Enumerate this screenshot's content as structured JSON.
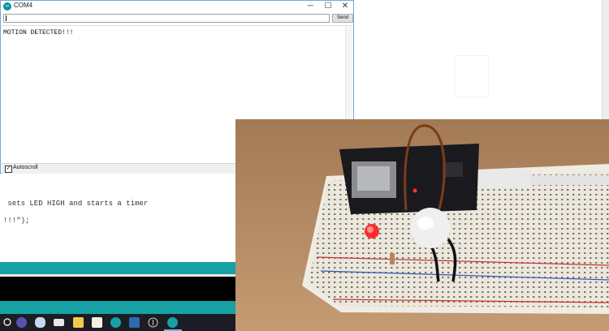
{
  "serial_monitor": {
    "title": "COM4",
    "send_label": "Send",
    "output_text": "MOTION DETECTED!!!",
    "autoscroll_label": "Autoscroll",
    "autoscroll_checked": "✓",
    "minimize_glyph": "─",
    "maximize_glyph": "☐",
    "close_glyph": "✕"
  },
  "code_editor": {
    "line1": " sets LED HIGH and starts a timer",
    "line2": "!!!\");"
  },
  "taskbar": {
    "icons": [
      "search-icon",
      "browser-icon",
      "mail-icon",
      "folder-icon",
      "document-icon",
      "arduino-icon",
      "notes-icon",
      "chrome-icon",
      "arduino-active-icon"
    ]
  },
  "colors": {
    "arduino_teal": "#17a1a5",
    "console_black": "#000000",
    "taskbar": "#1c1c24"
  }
}
